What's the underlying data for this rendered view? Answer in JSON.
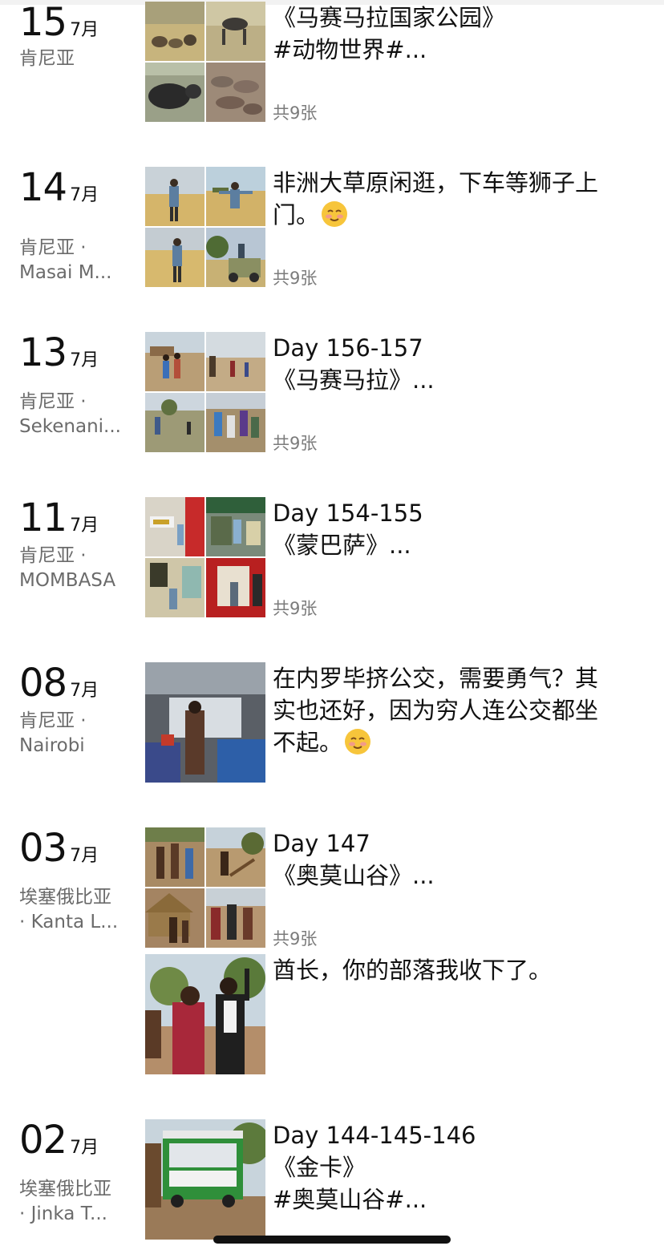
{
  "entries": [
    {
      "day": "15",
      "month": "7月",
      "location": [
        "肯尼亚"
      ],
      "text": [
        "《马赛马拉国家公园》",
        "#动物世界#..."
      ],
      "count": "共9张",
      "thumb_icons": [
        "savanna-animals-photo",
        "marabou-stork-photo",
        "buffalo-photo",
        "herd-photo"
      ]
    },
    {
      "day": "14",
      "month": "7月",
      "location": [
        "肯尼亚 ·",
        "Masai M..."
      ],
      "text": [
        "非洲大草原闲逛，下车等狮子上",
        "门。"
      ],
      "emoji": "smiling-face-emoji",
      "count": "共9张",
      "thumb_icons": [
        "grassland-person-photo",
        "grassland-arms-out-photo",
        "grassland-walking-photo",
        "safari-jeep-photo"
      ]
    },
    {
      "day": "13",
      "month": "7月",
      "location": [
        "肯尼亚 ·",
        "Sekenani..."
      ],
      "text": [
        "Day 156-157",
        "《马赛马拉》..."
      ],
      "count": "共9张",
      "thumb_icons": [
        "village-kids-photo",
        "village-road-photo",
        "village-path-photo",
        "children-group-photo"
      ]
    },
    {
      "day": "11",
      "month": "7月",
      "location": [
        "肯尼亚 ·",
        "MOMBASA"
      ],
      "text": [
        "Day 154-155",
        "《蒙巴萨》..."
      ],
      "count": "共9张",
      "thumb_icons": [
        "shop-sign-photo",
        "street-shop-photo",
        "painted-wall-photo",
        "red-store-photo"
      ]
    },
    {
      "day": "08",
      "month": "7月",
      "location": [
        "肯尼亚 ·",
        "Nairobi"
      ],
      "text": [
        "在内罗毕挤公交，需要勇气？其",
        "实也还好，因为穷人连公交都坐",
        "不起。"
      ],
      "emoji": "smiling-face-emoji",
      "count": "",
      "thumb_icons": [
        "bus-interior-photo"
      ]
    },
    {
      "day": "03",
      "month": "7月",
      "location": [
        "埃塞俄比亚",
        "· Kanta L..."
      ],
      "text": [
        "Day 147",
        "《奥莫山谷》..."
      ],
      "count": "共9张",
      "thumb_icons": [
        "tribe-kids-photo",
        "tribe-village-photo",
        "hut-children-photo",
        "tribe-group-photo"
      ],
      "sub": {
        "text": [
          "酋长，你的部落我收下了。"
        ],
        "thumb_icons": [
          "chief-portrait-photo"
        ]
      }
    },
    {
      "day": "02",
      "month": "7月",
      "location": [
        "埃塞俄比亚",
        "· Jinka T..."
      ],
      "text": [
        "Day 144-145-146",
        "《金卡》",
        "#奥莫山谷#..."
      ],
      "count": "",
      "thumb_icons": [
        "green-bus-photo"
      ]
    }
  ]
}
